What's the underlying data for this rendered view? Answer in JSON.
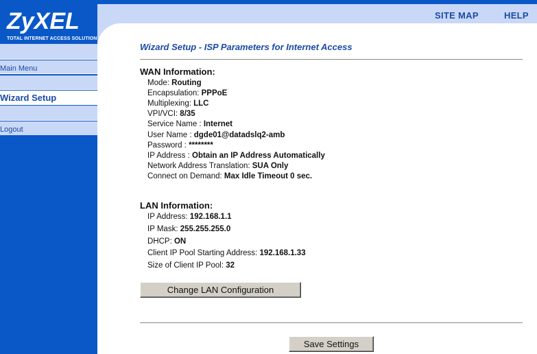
{
  "brand": {
    "logo": "ZyXEL",
    "tagline": "TOTAL INTERNET ACCESS SOLUTION"
  },
  "header": {
    "site_map": "SITE MAP",
    "help": "HELP"
  },
  "sidebar": {
    "items": [
      {
        "label": "Main Menu"
      },
      {
        "label": "Wizard Setup"
      },
      {
        "label": "Logout"
      }
    ]
  },
  "page": {
    "title": "Wizard Setup - ISP Parameters for Internet Access"
  },
  "wan": {
    "heading": "WAN Information:",
    "rows": [
      {
        "label": "Mode: ",
        "value": "Routing"
      },
      {
        "label": "Encapsulation: ",
        "value": "PPPoE"
      },
      {
        "label": "Multiplexing: ",
        "value": "LLC"
      },
      {
        "label": "VPI/VCI: ",
        "value": "8/35"
      },
      {
        "label": "Service Name : ",
        "value": "Internet"
      },
      {
        "label": "User Name : ",
        "value": "dgde01@datadslq2-amb"
      },
      {
        "label": "Password : ",
        "value": "********"
      },
      {
        "label": "IP Address : ",
        "value": "Obtain an IP Address Automatically"
      },
      {
        "label": "Network Address Translation: ",
        "value": "SUA Only"
      },
      {
        "label": "Connect on Demand: ",
        "value": "Max Idle Timeout 0 sec."
      }
    ]
  },
  "lan": {
    "heading": "LAN Information:",
    "rows": [
      {
        "label": "IP Address: ",
        "value": "192.168.1.1"
      },
      {
        "label": "IP Mask: ",
        "value": "255.255.255.0"
      },
      {
        "label": "DHCP: ",
        "value": "ON"
      },
      {
        "label": "Client IP Pool Starting Address: ",
        "value": "192.168.1.33"
      },
      {
        "label": "Size of Client IP Pool: ",
        "value": "32"
      }
    ]
  },
  "buttons": {
    "change_lan": "Change LAN Configuration",
    "save": "Save Settings"
  },
  "colors": {
    "brand_blue": "#0a58c8",
    "light_blue": "#c9d8f6",
    "link_blue": "#1a4aa6"
  }
}
